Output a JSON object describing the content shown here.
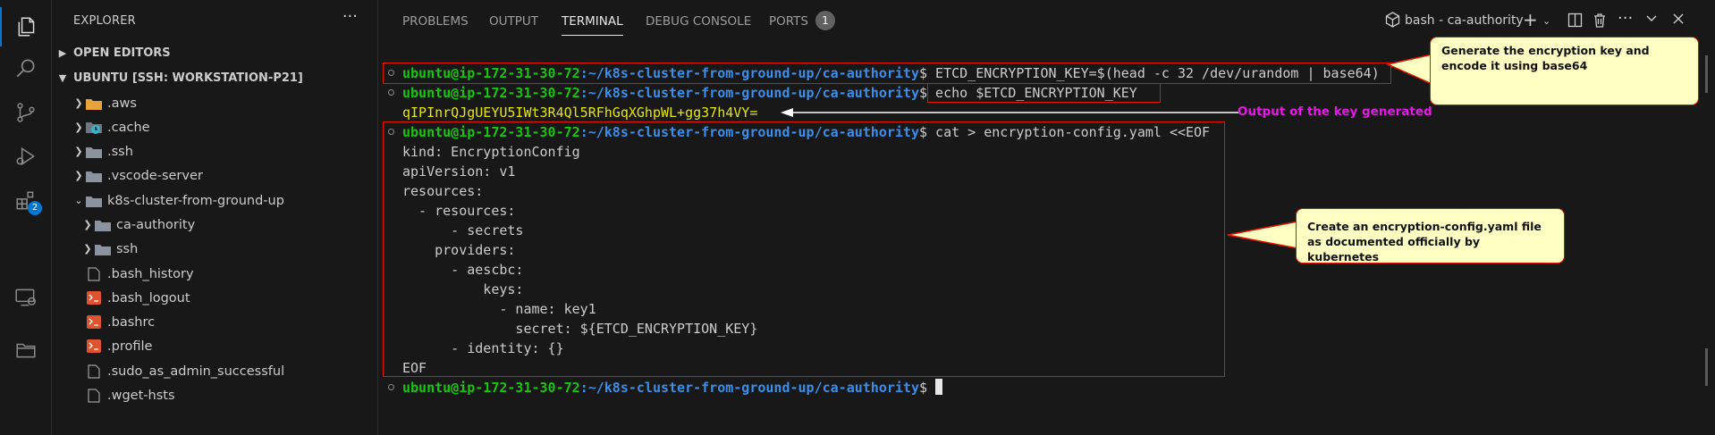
{
  "sidebar": {
    "title": "EXPLORER",
    "more": "···",
    "open_editors": "OPEN EDITORS",
    "workspace": "UBUNTU [SSH: WORKSTATION-P21]",
    "items": [
      {
        "label": ".aws"
      },
      {
        "label": ".cache"
      },
      {
        "label": ".ssh"
      },
      {
        "label": ".vscode-server"
      },
      {
        "label": "k8s-cluster-from-ground-up"
      },
      {
        "label": "ca-authority"
      },
      {
        "label": "ssh"
      },
      {
        "label": ".bash_history"
      },
      {
        "label": ".bash_logout"
      },
      {
        "label": ".bashrc"
      },
      {
        "label": ".profile"
      },
      {
        "label": ".sudo_as_admin_successful"
      },
      {
        "label": ".wget-hsts"
      }
    ]
  },
  "activity": {
    "extensions_badge": "2",
    "icons": [
      "files-icon",
      "search-icon",
      "source-control-icon",
      "run-debug-icon",
      "extensions-icon",
      "remote-explorer-icon",
      "folder-icon"
    ]
  },
  "panel": {
    "tabs": {
      "problems": "PROBLEMS",
      "output": "OUTPUT",
      "terminal": "TERMINAL",
      "debug_console": "DEBUG CONSOLE",
      "ports": "PORTS",
      "ports_count": "1"
    },
    "terminal_name": "bash - ca-authority"
  },
  "terminal": {
    "prompt_host": "ubuntu@ip-172-31-30-72",
    "prompt_path": ":~/k8s-cluster-from-ground-up/ca-authority",
    "prompt_sign": "$",
    "cmd1": " ETCD_ENCRYPTION_KEY=$(head -c 32 /dev/urandom | base64)",
    "cmd2": " echo $ETCD_ENCRYPTION_KEY",
    "key_output": "qIPInrQJgUEYU5IWt3R4Ql5RFhGqXGhpWL+gg37h4VY=",
    "cmd3": " cat > encryption-config.yaml <<EOF",
    "yaml": [
      "kind: EncryptionConfig",
      "apiVersion: v1",
      "resources:",
      "  - resources:",
      "      - secrets",
      "    providers:",
      "      - aescbc:",
      "          keys:",
      "            - name: key1",
      "              secret: ${ETCD_ENCRYPTION_KEY}",
      "      - identity: {}",
      "EOF"
    ]
  },
  "annotations": {
    "callout1": "Generate the encryption key and encode it using base64",
    "output_label": "Output of the key generated",
    "callout2": "Create an encryption-config.yaml file as documented officially by kubernetes"
  },
  "colors": {
    "prompt_host": "#16c60c",
    "prompt_path": "#3b8eea",
    "key_output": "#e5e510",
    "highlight_box": "#e51400",
    "callout_bg": "#ffffc4",
    "label_magenta": "#e51ae5",
    "accent": "#0078d4"
  }
}
